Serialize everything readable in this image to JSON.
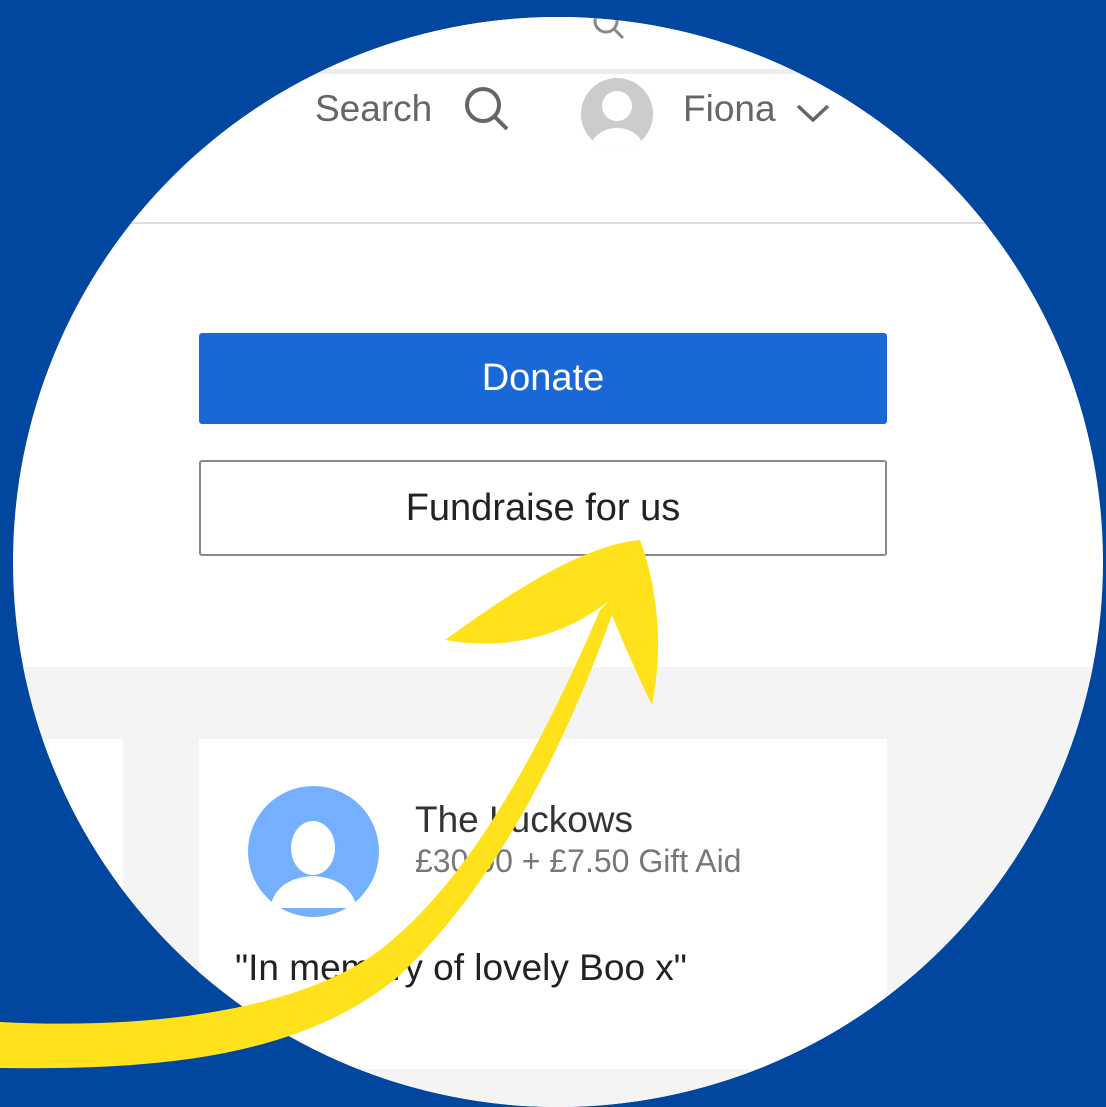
{
  "header": {
    "search_label": "Search",
    "user_name": "Fiona"
  },
  "actions": {
    "donate_label": "Donate",
    "fundraise_label": "Fundraise for us"
  },
  "donation": {
    "donor_name": "The Luckows",
    "amount": "£30.00 + £7.50 Gift Aid",
    "message": "\"In memory of lovely Boo x\""
  },
  "colors": {
    "background": "#02479f",
    "donate_button": "#1a67d8",
    "arrow": "#ffe21c",
    "donor_avatar": "#74b0ff"
  },
  "icons": [
    "search-icon",
    "user-avatar-icon",
    "chevron-down-icon",
    "arrow-annotation-icon"
  ]
}
